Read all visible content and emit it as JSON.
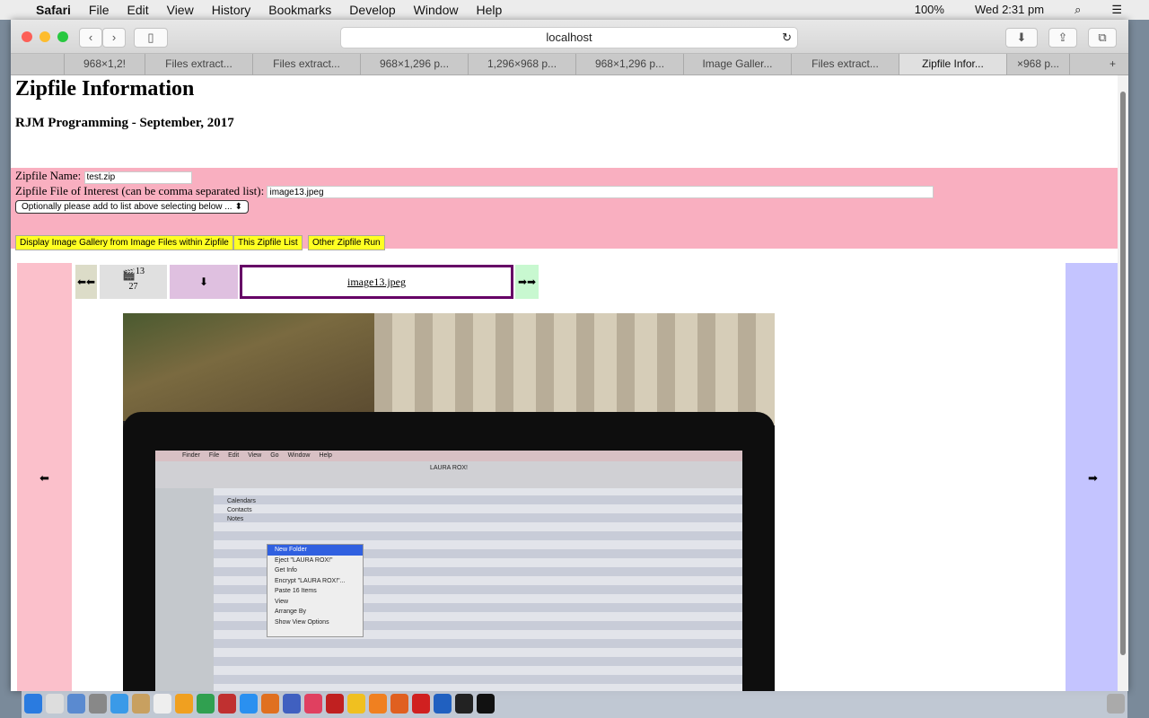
{
  "menubar": {
    "apple": "",
    "items": [
      "Safari",
      "File",
      "Edit",
      "View",
      "History",
      "Bookmarks",
      "Develop",
      "Window",
      "Help"
    ],
    "battery": "100%",
    "clock": "Wed 2:31 pm"
  },
  "browser": {
    "url": "localhost",
    "tabs": [
      "968×1,2!",
      "Files extract...",
      "Files extract...",
      "968×1,296 p...",
      "1,296×968 p...",
      "968×1,296 p...",
      "Image Galler...",
      "Files extract...",
      "Zipfile Infor...",
      "×968 p..."
    ],
    "active_tab": 8
  },
  "page": {
    "title": "Zipfile Information",
    "subtitle": "RJM Programming - September, 2017",
    "zip_name_label": "Zipfile Name:",
    "zip_name_value": "test.zip",
    "interest_label": "Zipfile File of Interest (can be comma separated list):",
    "interest_value": "image13.jpeg",
    "select_value": "Optionally please add to list above selecting below ...",
    "buttons": [
      "Display Image Gallery from Image Files within Zipfile",
      "This Zipfile List",
      "Other Zipfile Run"
    ],
    "gallery": {
      "first": "⬅⬅",
      "icon": "🎬",
      "index": "13",
      "total": "27",
      "download": "⬇",
      "filename": "image13.jpeg",
      "last": "➡➡",
      "prev": "⬅",
      "next": "➡"
    },
    "photo_screen": {
      "menu": [
        "Finder",
        "File",
        "Edit",
        "View",
        "Go",
        "Window",
        "Help"
      ],
      "window_title": "LAURA ROX!",
      "folders": [
        "Calendars",
        "Contacts",
        "Notes"
      ],
      "context_menu": [
        "New Folder",
        "Eject \"LAURA ROX!\"",
        "Get Info",
        "Encrypt \"LAURA ROX!\"...",
        "Paste 16 Items",
        "View",
        "Arrange By",
        "Show View Options"
      ]
    }
  },
  "colors": {
    "form_bg": "#f9afc0",
    "button_bg": "#ffff22",
    "left_panel": "#fbc0cb",
    "right_panel": "#c4c4ff",
    "filename_border": "#660066"
  }
}
